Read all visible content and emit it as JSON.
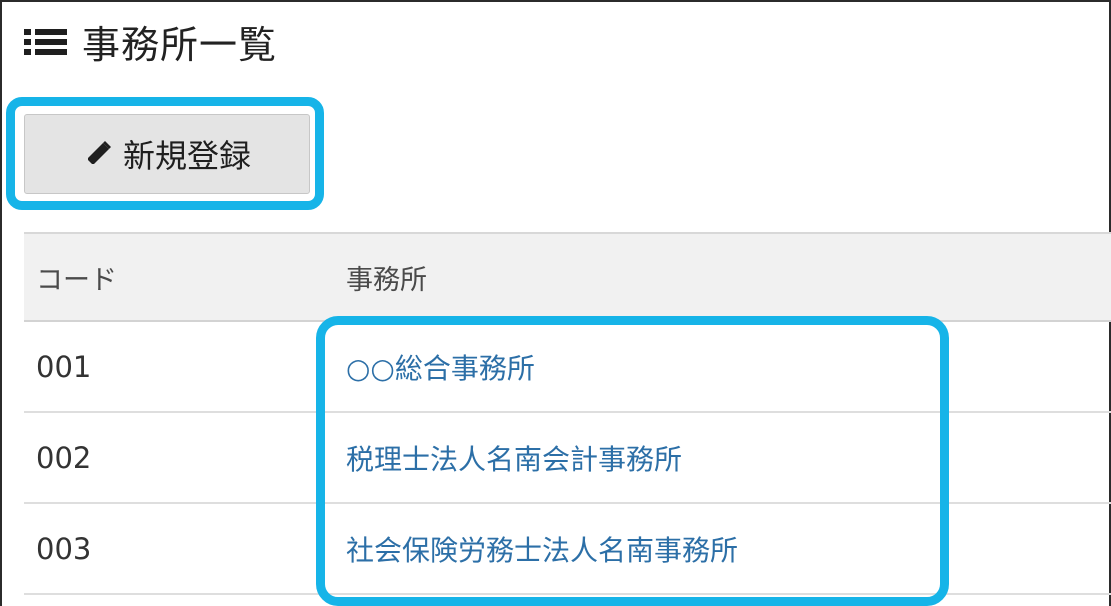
{
  "header": {
    "title": "事務所一覧",
    "icon": "list-icon"
  },
  "actions": {
    "new_label": "新規登録",
    "new_icon": "pencil-icon"
  },
  "table": {
    "columns": [
      "コード",
      "事務所"
    ],
    "rows": [
      {
        "code": "001",
        "office": "○○総合事務所"
      },
      {
        "code": "002",
        "office": "税理士法人名南会計事務所"
      },
      {
        "code": "003",
        "office": "社会保険労務士法人名南事務所"
      }
    ]
  },
  "colors": {
    "highlight": "#16b4e8",
    "link": "#2c6fa7",
    "button_bg": "#e4e4e4",
    "header_bg": "#f1f1f1"
  }
}
